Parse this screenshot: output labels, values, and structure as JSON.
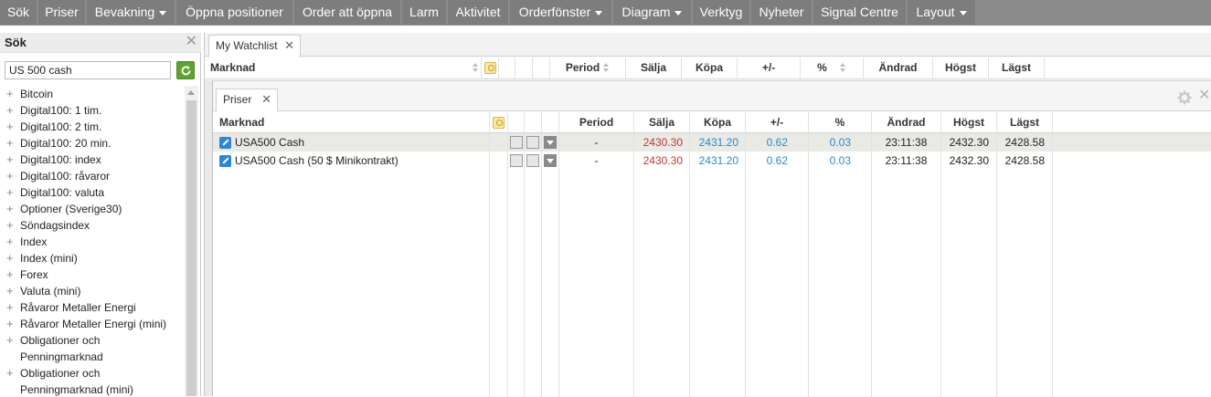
{
  "menu": {
    "items": [
      {
        "label": "Sök",
        "dropdown": false
      },
      {
        "label": "Priser",
        "dropdown": false
      },
      {
        "label": "Bevakning",
        "dropdown": true
      },
      {
        "label": "Öppna positioner",
        "dropdown": false
      },
      {
        "label": "Order att öppna",
        "dropdown": false
      },
      {
        "label": "Larm",
        "dropdown": false
      },
      {
        "label": "Aktivitet",
        "dropdown": false
      },
      {
        "label": "Orderfönster",
        "dropdown": true
      },
      {
        "label": "Diagram",
        "dropdown": true
      },
      {
        "label": "Verktyg",
        "dropdown": false
      },
      {
        "label": "Nyheter",
        "dropdown": false
      },
      {
        "label": "Signal Centre",
        "dropdown": false
      },
      {
        "label": "Layout",
        "dropdown": true
      }
    ]
  },
  "search_panel": {
    "title": "Sök",
    "query": "US 500 cash",
    "tree": [
      "Bitcoin",
      "Digital100: 1 tim.",
      "Digital100: 2 tim.",
      "Digital100: 20 min.",
      "Digital100: index",
      "Digital100: råvaror",
      "Digital100: valuta",
      "Optioner (Sverige30)",
      "Söndagsindex",
      "Index",
      "Index (mini)",
      "Forex",
      "Valuta (mini)",
      "Råvaror Metaller Energi",
      "Råvaror Metaller Energi (mini)",
      "Obligationer och Penningmarknad",
      "Obligationer och Penningmarknad (mini)"
    ]
  },
  "watchlist": {
    "tab_label": "My Watchlist",
    "columns": {
      "market": "Marknad",
      "period": "Period",
      "sell": "Sälja",
      "buy": "Köpa",
      "change": "+/-",
      "percent": "%",
      "updated": "Ändrad",
      "high": "Högst",
      "low": "Lägst"
    }
  },
  "priser": {
    "tab_label": "Priser",
    "columns": {
      "market": "Marknad",
      "period": "Period",
      "sell": "Sälja",
      "buy": "Köpa",
      "change": "+/-",
      "percent": "%",
      "updated": "Ändrad",
      "high": "Högst",
      "low": "Lägst"
    },
    "rows": [
      {
        "market": "USA500 Cash",
        "period": "-",
        "sell": "2430.30",
        "buy": "2431.20",
        "change": "0.62",
        "percent": "0.03",
        "updated": "23:11:38",
        "high": "2432.30",
        "low": "2428.58"
      },
      {
        "market": "USA500 Cash (50 $ Minikontrakt)",
        "period": "-",
        "sell": "2430.30",
        "buy": "2431.20",
        "change": "0.62",
        "percent": "0.03",
        "updated": "23:11:38",
        "high": "2432.30",
        "low": "2428.58"
      }
    ]
  },
  "colors": {
    "sell": "#d0302b",
    "buy": "#2a8ad4",
    "menu_bg": "#7d7d7d",
    "search_button": "#5fa233"
  }
}
